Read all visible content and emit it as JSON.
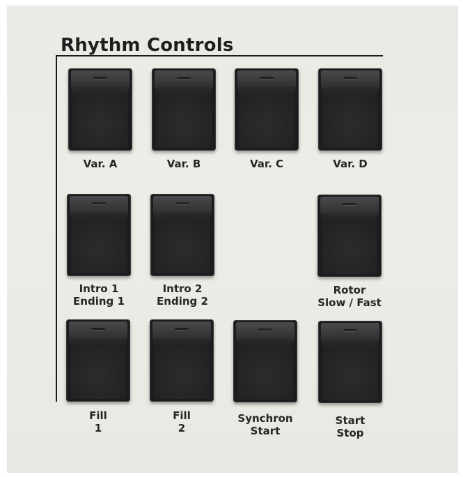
{
  "panel": {
    "title": "Rhythm Controls"
  },
  "buttons": [
    {
      "id": "var-a",
      "lines": [
        "Var. A"
      ]
    },
    {
      "id": "var-b",
      "lines": [
        "Var. B"
      ]
    },
    {
      "id": "var-c",
      "lines": [
        "Var. C"
      ]
    },
    {
      "id": "var-d",
      "lines": [
        "Var. D"
      ]
    },
    {
      "id": "intro-1-ending-1",
      "lines": [
        "Intro 1",
        "Ending 1"
      ]
    },
    {
      "id": "intro-2-ending-2",
      "lines": [
        "Intro 2",
        "Ending 2"
      ]
    },
    {
      "id": "rotor-slow-fast",
      "lines": [
        "Rotor",
        "Slow / Fast"
      ]
    },
    {
      "id": "fill-1",
      "lines": [
        "Fill",
        "1"
      ]
    },
    {
      "id": "fill-2",
      "lines": [
        "Fill",
        "2"
      ]
    },
    {
      "id": "synchron-start",
      "lines": [
        "Synchron",
        "Start"
      ]
    },
    {
      "id": "start-stop",
      "lines": [
        "Start",
        "Stop"
      ]
    }
  ]
}
